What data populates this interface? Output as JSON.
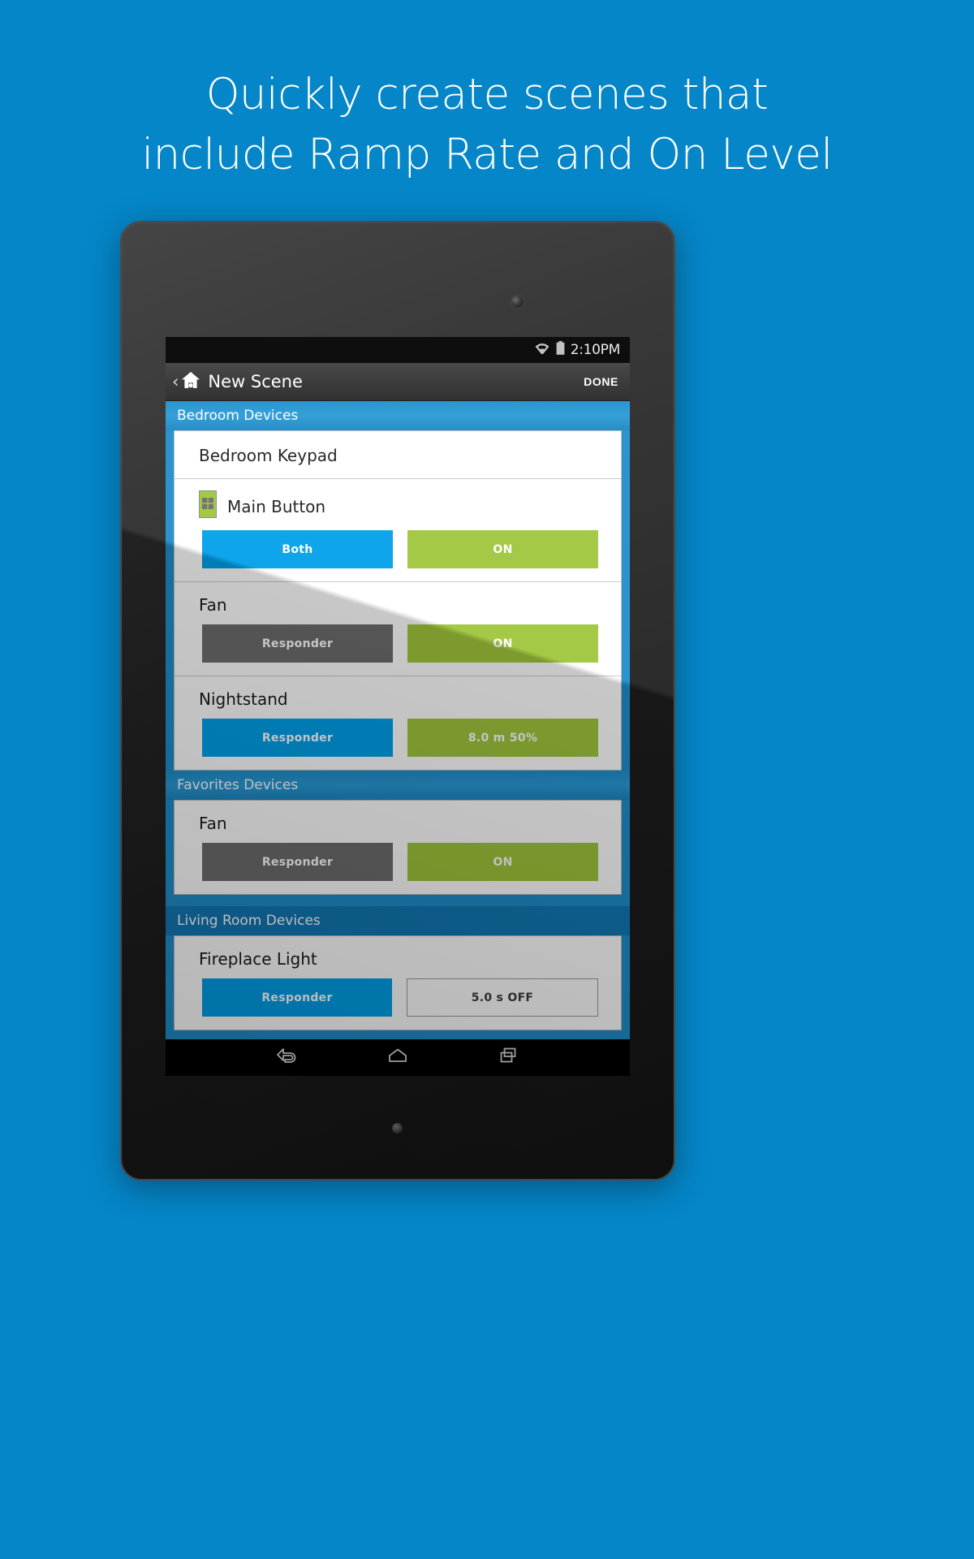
{
  "promo": {
    "line1": "Quickly create scenes that",
    "line2": "include Ramp Rate and On Level",
    "background_color": "#0586c8"
  },
  "statusbar": {
    "time": "2:10PM",
    "wifi_icon": "wifi-icon",
    "battery_icon": "battery-icon"
  },
  "actionbar": {
    "back_icon": "‹",
    "home_icon": "home-icon",
    "title": "New Scene",
    "done_label": "DONE"
  },
  "colors": {
    "accent_blue": "#00a0e9",
    "section_blue": "#1f8ecb",
    "green": "#9fc63b",
    "gray": "#6d6d6d"
  },
  "sections": [
    {
      "header": "Bedroom Devices",
      "cards": [
        {
          "title": "Bedroom Keypad",
          "devices": [
            {
              "name": "Main Button",
              "icon": "keypad-icon",
              "left_button": {
                "label": "Both",
                "style": "blue"
              },
              "right_button": {
                "label": "ON",
                "style": "green"
              }
            },
            {
              "name": "Fan",
              "icon": null,
              "left_button": {
                "label": "Responder",
                "style": "gray"
              },
              "right_button": {
                "label": "ON",
                "style": "green"
              }
            },
            {
              "name": "Nightstand",
              "icon": null,
              "left_button": {
                "label": "Responder",
                "style": "blue"
              },
              "right_button": {
                "label": "8.0 m   50%",
                "style": "green"
              }
            }
          ]
        }
      ]
    },
    {
      "header": "Favorites Devices",
      "cards": [
        {
          "title": null,
          "devices": [
            {
              "name": "Fan",
              "icon": null,
              "left_button": {
                "label": "Responder",
                "style": "gray"
              },
              "right_button": {
                "label": "ON",
                "style": "green"
              }
            }
          ]
        }
      ]
    },
    {
      "header": "Living Room Devices",
      "cards": [
        {
          "title": null,
          "devices": [
            {
              "name": "Fireplace Light",
              "icon": null,
              "left_button": {
                "label": "Responder",
                "style": "blue"
              },
              "right_button": {
                "label": "5.0 s   OFF",
                "style": "outline"
              }
            }
          ]
        }
      ]
    }
  ],
  "navbar": {
    "back_icon": "back-arrow-icon",
    "home_icon": "home-pentagon-icon",
    "recents_icon": "recents-icon"
  }
}
